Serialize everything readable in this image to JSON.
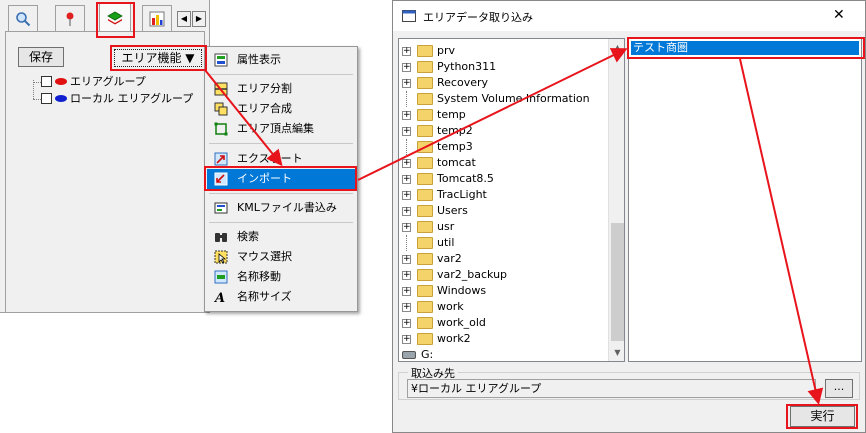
{
  "left_panel": {
    "save_label": "保存",
    "area_function_label": "エリア機能 ▼",
    "tree": [
      {
        "label": "エリアグループ",
        "color": "#e01010"
      },
      {
        "label": "ローカル エリアグループ",
        "color": "#1020d0"
      }
    ]
  },
  "context_menu": {
    "items": [
      {
        "label": "属性表示",
        "icon": "attribute-icon"
      },
      {
        "label": "エリア分割",
        "icon": "split-icon"
      },
      {
        "label": "エリア合成",
        "icon": "merge-icon"
      },
      {
        "label": "エリア頂点編集",
        "icon": "vertex-edit-icon"
      },
      {
        "label": "エクスポート",
        "icon": "export-icon"
      },
      {
        "label": "インポート",
        "icon": "import-icon"
      },
      {
        "label": "KMLファイル書込み",
        "icon": "kml-icon"
      },
      {
        "label": "検索",
        "icon": "binoculars-icon"
      },
      {
        "label": "マウス選択",
        "icon": "mouse-select-icon"
      },
      {
        "label": "名称移動",
        "icon": "label-move-icon"
      },
      {
        "label": "名称サイズ",
        "icon": "font-size-icon"
      }
    ]
  },
  "dialog": {
    "title": "エリアデータ取り込み",
    "close_label": "✕",
    "folders": [
      {
        "name": "prv",
        "expandable": true
      },
      {
        "name": "Python311",
        "expandable": true
      },
      {
        "name": "Recovery",
        "expandable": true
      },
      {
        "name": "System Volume Information",
        "expandable": false
      },
      {
        "name": "temp",
        "expandable": true
      },
      {
        "name": "temp2",
        "expandable": true
      },
      {
        "name": "temp3",
        "expandable": false
      },
      {
        "name": "tomcat",
        "expandable": true
      },
      {
        "name": "Tomcat8.5",
        "expandable": true
      },
      {
        "name": "TracLight",
        "expandable": true
      },
      {
        "name": "Users",
        "expandable": true
      },
      {
        "name": "usr",
        "expandable": true
      },
      {
        "name": "util",
        "expandable": false
      },
      {
        "name": "var2",
        "expandable": true
      },
      {
        "name": "var2_backup",
        "expandable": true
      },
      {
        "name": "Windows",
        "expandable": true
      },
      {
        "name": "work",
        "expandable": true
      },
      {
        "name": "work_old",
        "expandable": true
      },
      {
        "name": "work2",
        "expandable": true
      }
    ],
    "drive_label": "G:",
    "selected_file": "テスト商圏",
    "destination_label": "取込み先",
    "destination_value": "¥ローカル エリアグループ",
    "browse_label": "...",
    "execute_label": "実行"
  },
  "colors": {
    "selection": "#0078d7",
    "annotation": "#e8141c"
  }
}
